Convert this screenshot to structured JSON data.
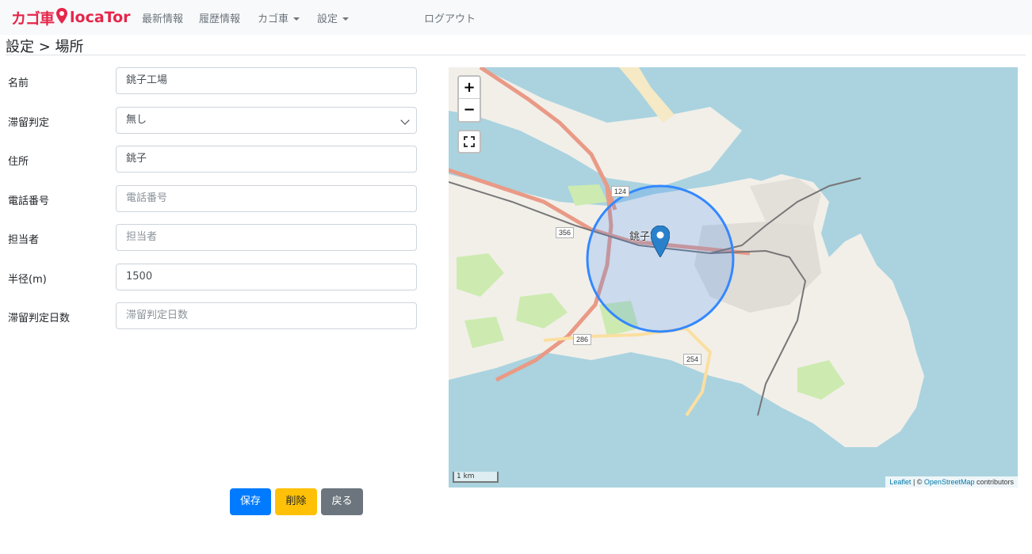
{
  "nav": {
    "brand_kago": "カゴ車",
    "brand_loca": "locaTor",
    "latest": "最新情報",
    "history": "履歴情報",
    "kago": "カゴ車",
    "settings": "設定",
    "logout": "ログアウト"
  },
  "page": {
    "title": "設定 > 場所"
  },
  "form": {
    "name": {
      "label": "名前",
      "value": "銚子工場"
    },
    "stay": {
      "label": "滞留判定",
      "value": "無し"
    },
    "address": {
      "label": "住所",
      "value": "銚子"
    },
    "phone": {
      "label": "電話番号",
      "placeholder": "電話番号"
    },
    "person": {
      "label": "担当者",
      "placeholder": "担当者"
    },
    "radius": {
      "label": "半径(m)",
      "value": "1500"
    },
    "stay_days": {
      "label": "滞留判定日数",
      "placeholder": "滞留判定日数"
    }
  },
  "buttons": {
    "save": "保存",
    "delete": "削除",
    "back": "戻る"
  },
  "map": {
    "zoom_in": "+",
    "zoom_out": "−",
    "scale": "1 km",
    "attribution_leaflet": "Leaflet",
    "attribution_sep": " | © ",
    "attribution_osm": "OpenStreetMap",
    "attribution_suffix": " contributors",
    "city_label": "銚子市",
    "shields": [
      "124",
      "356",
      "286",
      "254"
    ],
    "colors": {
      "water": "#aad3df",
      "land": "#f2efe9",
      "circle": "#3388ff",
      "marker": "#2a81cb"
    }
  }
}
